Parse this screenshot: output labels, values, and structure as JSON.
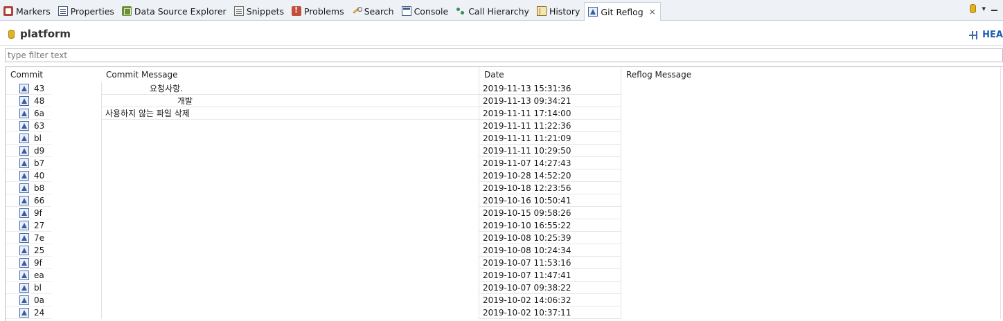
{
  "tabs": [
    {
      "label": "Markers",
      "icon": "markers-icon",
      "cls": "ico-markers"
    },
    {
      "label": "Properties",
      "icon": "properties-icon",
      "cls": "ico-props"
    },
    {
      "label": "Data Source Explorer",
      "icon": "data-source-explorer-icon",
      "cls": "ico-dse"
    },
    {
      "label": "Snippets",
      "icon": "snippets-icon",
      "cls": "ico-snip"
    },
    {
      "label": "Problems",
      "icon": "problems-icon",
      "cls": "ico-prob"
    },
    {
      "label": "Search",
      "icon": "search-icon",
      "cls": "ico-search"
    },
    {
      "label": "Console",
      "icon": "console-icon",
      "cls": "ico-console"
    },
    {
      "label": "Call Hierarchy",
      "icon": "call-hierarchy-icon",
      "cls": "ico-callh"
    },
    {
      "label": "History",
      "icon": "history-icon",
      "cls": "ico-hist"
    },
    {
      "label": "Git Reflog",
      "icon": "git-reflog-icon",
      "cls": "ico-reflog",
      "active": true,
      "close": "⨯"
    }
  ],
  "toolbar": {
    "menu_glyph": "▾"
  },
  "header": {
    "repo": "platform",
    "head": "HEA"
  },
  "filter": {
    "placeholder": "type filter text"
  },
  "table": {
    "columns": [
      "Commit",
      "Commit Message",
      "Date",
      "Reflog Message"
    ],
    "rows": [
      {
        "commit": "43",
        "message": "요청사항.",
        "indent": 64,
        "date": "2019-11-13 15:31:36"
      },
      {
        "commit": "48",
        "message": "개발",
        "indent": 104,
        "date": "2019-11-13 09:34:21"
      },
      {
        "commit": "6a",
        "message": "사용하지 않는 파일 삭제",
        "indent": 0,
        "date": "2019-11-11 17:14:00"
      },
      {
        "commit": "63",
        "message": "",
        "indent": 0,
        "date": "2019-11-11 11:22:36"
      },
      {
        "commit": "bl",
        "message": "",
        "indent": 0,
        "date": "2019-11-11 11:21:09"
      },
      {
        "commit": "d9",
        "message": "",
        "indent": 0,
        "date": "2019-11-11 10:29:50"
      },
      {
        "commit": "b7",
        "message": "",
        "indent": 0,
        "date": "2019-11-07 14:27:43"
      },
      {
        "commit": "40",
        "message": "",
        "indent": 0,
        "date": "2019-10-28 14:52:20"
      },
      {
        "commit": "b8",
        "message": "",
        "indent": 0,
        "date": "2019-10-18 12:23:56"
      },
      {
        "commit": "66",
        "message": "",
        "indent": 0,
        "date": "2019-10-16 10:50:41"
      },
      {
        "commit": "9f",
        "message": "",
        "indent": 0,
        "date": "2019-10-15 09:58:26"
      },
      {
        "commit": "27",
        "message": "",
        "indent": 0,
        "date": "2019-10-10 16:55:22"
      },
      {
        "commit": "7e",
        "message": "",
        "indent": 0,
        "date": "2019-10-08 10:25:39"
      },
      {
        "commit": "25",
        "message": "",
        "indent": 0,
        "date": "2019-10-08 10:24:34"
      },
      {
        "commit": "9f",
        "message": "",
        "indent": 0,
        "date": "2019-10-07 11:53:16"
      },
      {
        "commit": "ea",
        "message": "",
        "indent": 0,
        "date": "2019-10-07 11:47:41"
      },
      {
        "commit": "bl",
        "message": "",
        "indent": 0,
        "date": "2019-10-07 09:38:22"
      },
      {
        "commit": "0a",
        "message": "",
        "indent": 0,
        "date": "2019-10-02 14:06:32"
      },
      {
        "commit": "24",
        "message": "",
        "indent": 0,
        "date": "2019-10-02 10:37:11"
      }
    ]
  }
}
